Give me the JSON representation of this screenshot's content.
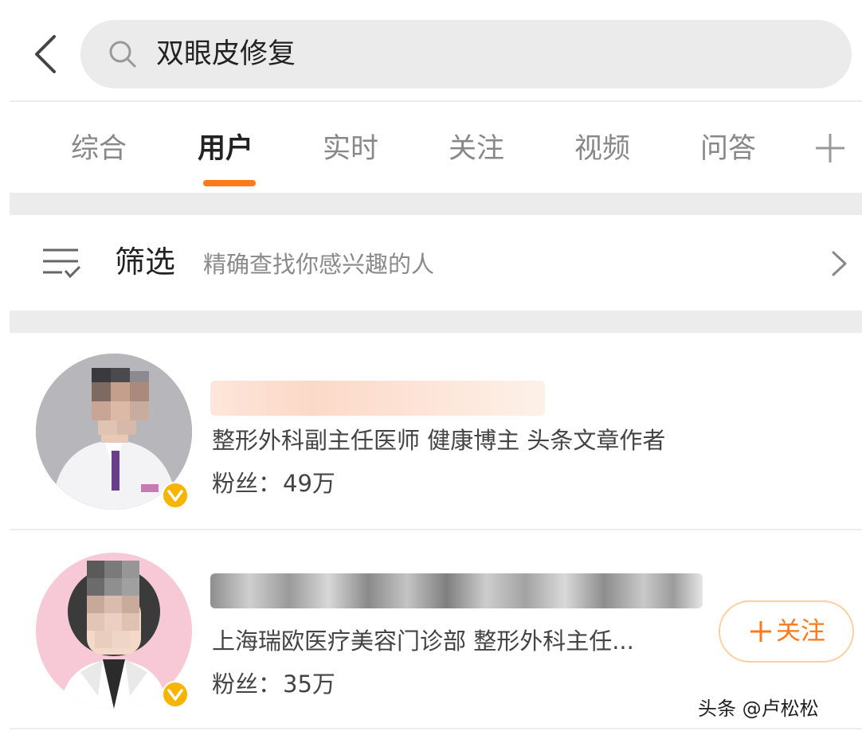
{
  "search": {
    "query": "双眼皮修复"
  },
  "tabs": [
    {
      "label": "综合",
      "active": false
    },
    {
      "label": "用户",
      "active": true
    },
    {
      "label": "实时",
      "active": false
    },
    {
      "label": "关注",
      "active": false
    },
    {
      "label": "视频",
      "active": false
    },
    {
      "label": "问答",
      "active": false
    }
  ],
  "filter": {
    "label": "筛选",
    "hint": "精确查找你感兴趣的人"
  },
  "users": [
    {
      "description": "整形外科副主任医师 健康博主 头条文章作者",
      "fans_label": "粉丝：",
      "fans_value": "49万",
      "verified_color": "#f7b500"
    },
    {
      "description": "上海瑞欧医疗美容门诊部 整形外科主任...",
      "fans_label": "粉丝：",
      "fans_value": "35万",
      "follow_label": "关注",
      "verified_color": "#f7b500"
    }
  ],
  "watermark": "头条 @卢松松",
  "colors": {
    "accent": "#ff7a1a",
    "divider": "#ececec",
    "search_bg": "#ebebeb"
  },
  "icons": {
    "back": "chevron-left-icon",
    "search": "search-icon",
    "add_tab": "plus-icon",
    "filter": "filter-list-icon",
    "more": "chevron-right-icon",
    "verified": "verified-badge-icon"
  }
}
